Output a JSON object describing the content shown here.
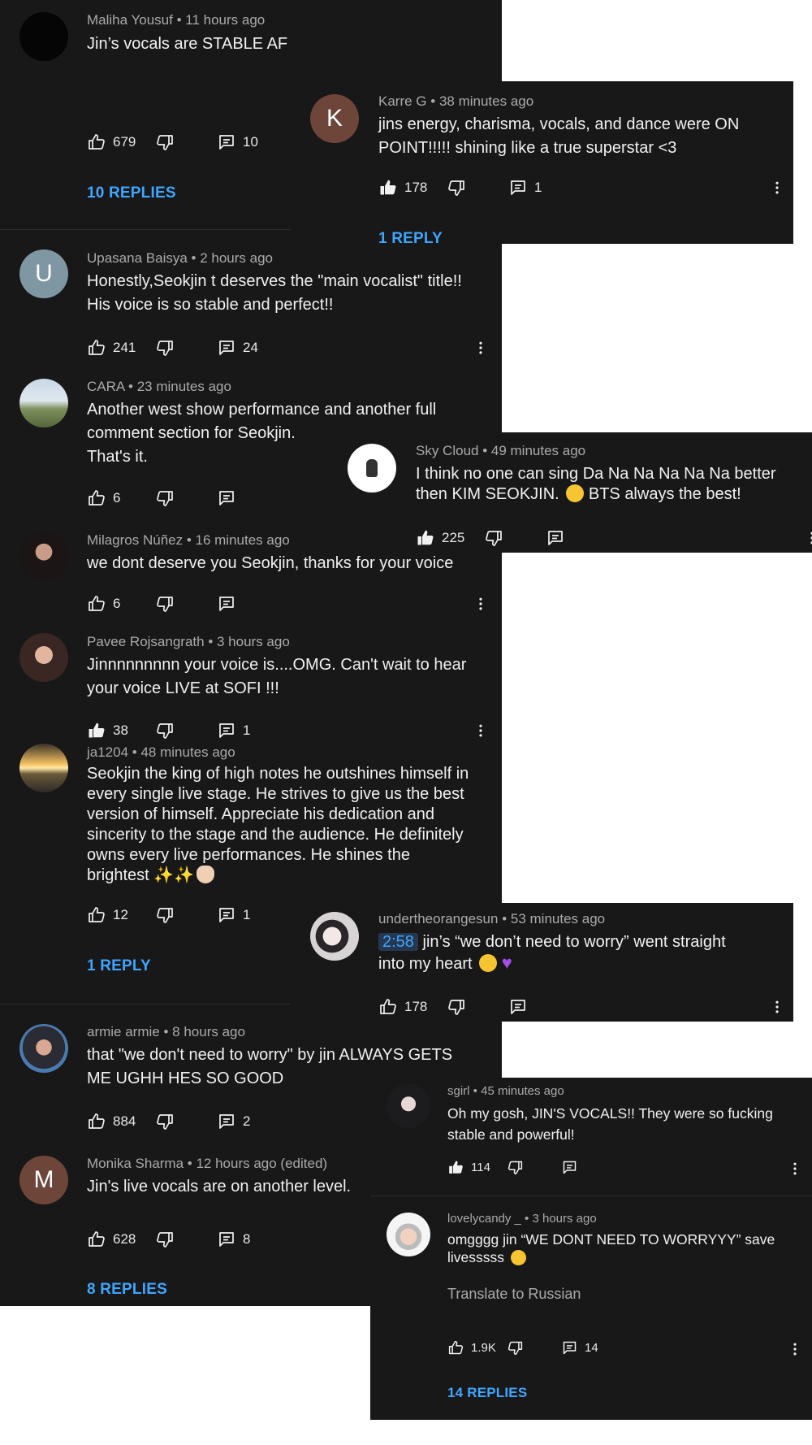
{
  "c1": {
    "author": "Maliha Yousuf",
    "time": "11 hours ago",
    "text": "Jin’s vocals are STABLE AF",
    "likes": "679",
    "replies_count": "10",
    "replies": "10 REPLIES"
  },
  "c2": {
    "initial": "K",
    "author": "Karre G",
    "time": "38 minutes ago",
    "text": "jins energy, charisma, vocals, and dance were ON POINT!!!!! shining like a true superstar <3",
    "likes": "178",
    "replies_count": "1",
    "replies": "1 REPLY",
    "avatar_color": "#6d4539"
  },
  "c3": {
    "initial": "U",
    "author": "Upasana Baisya",
    "time": "2 hours ago",
    "text": "Honestly,Seokjin t deserves the \"main vocalist\" title!! His voice  is so stable and perfect!!",
    "likes": "241",
    "replies_count": "24",
    "avatar_color": "#7f97a3"
  },
  "c4": {
    "author": "CARA",
    "time": "23 minutes ago",
    "line1": "Another west show performance and another full",
    "line2": "comment section for Seokjin.",
    "line3": "That's it.",
    "likes": "6"
  },
  "c5": {
    "author": "Sky Cloud",
    "time": "49 minutes ago",
    "line1": "I think no one can sing Da Na Na Na Na Na better",
    "line2": "then KIM SEOKJIN.",
    "line2b": "BTS always the best!",
    "likes": "225"
  },
  "c6": {
    "author": "Milagros Núñez",
    "time": "16 minutes ago",
    "text": "we dont deserve you Seokjin, thanks for your voice",
    "likes": "6"
  },
  "c7": {
    "author": "Pavee Rojsangrath",
    "time": "3 hours ago",
    "text": "Jinnnnnnnnn your voice is....OMG. Can't wait to hear your voice LIVE at SOFI !!!",
    "likes": "38",
    "replies_count": "1"
  },
  "c8": {
    "author": "ja1204",
    "time": "48 minutes ago",
    "text": "Seokjin the king of high notes he outshines himself in every single live stage. He strives to give us the best version of himself. Appreciate his dedication and sincerity to the stage and the audience. He definitely owns every live performances. He shines the brightest",
    "likes": "12",
    "replies_count": "1",
    "replies": "1 REPLY"
  },
  "c9": {
    "author": "undertheorangesun",
    "time": "53 minutes ago",
    "timestamp": "2:58",
    "line1": "jin’s “we don’t need to worry” went straight",
    "line2": "into my heart",
    "likes": "178"
  },
  "c10": {
    "author": "armie armie",
    "time": "8 hours ago",
    "text": "that \"we don't need to worry\" by jin ALWAYS GETS ME UGHH HES SO GOOD",
    "likes": "884",
    "replies_count": "2"
  },
  "c11": {
    "author": "sgirl",
    "time": "45 minutes ago",
    "text": "Oh my gosh, JIN'S VOCALS!! They were so fucking stable and powerful!",
    "likes": "114"
  },
  "c12": {
    "initial": "M",
    "author": "Monika Sharma",
    "time": "12 hours ago (edited)",
    "text": "Jin's live vocals are on another level.",
    "likes": "628",
    "replies_count": "8",
    "replies": "8 REPLIES",
    "avatar_color": "#6d4539"
  },
  "c13": {
    "author": "lovelycandy _",
    "time": "3 hours ago",
    "text": "omgggg jin “WE DONT NEED TO WORRYYY” save livesssss",
    "translate": "Translate to Russian",
    "likes": "1.9K",
    "replies_count": "14",
    "replies": "14 REPLIES"
  },
  "colors": {
    "card_bg": "#181818",
    "link": "#3ea6ff",
    "meta": "#aaaaaa",
    "text": "#f1f1f1"
  },
  "icons": [
    "like-icon",
    "liked-icon",
    "dislike-icon",
    "reply-icon",
    "more-icon"
  ]
}
